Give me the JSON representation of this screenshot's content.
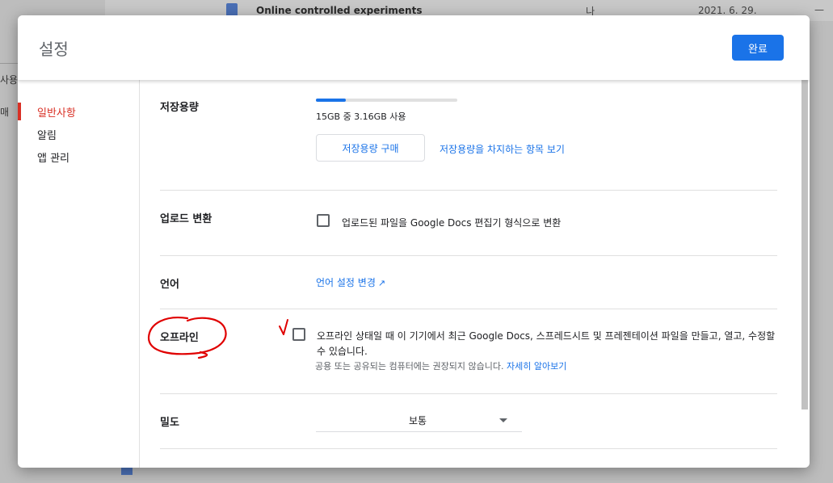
{
  "background": {
    "file_title": "Online controlled experiments",
    "owner": "나",
    "date": "2021. 6. 29.",
    "size": "—",
    "side_a": "사용",
    "side_b": "매"
  },
  "dialog": {
    "title": "설정",
    "done_label": "완료"
  },
  "sidebar": {
    "items": [
      {
        "label": "일반사항",
        "active": true
      },
      {
        "label": "알림",
        "active": false
      },
      {
        "label": "앱 관리",
        "active": false
      }
    ]
  },
  "storage": {
    "label": "저장용량",
    "usage_text": "15GB 중 3.16GB 사용",
    "used_fraction": 0.21,
    "buy_label": "저장용량 구매",
    "view_link": "저장용량을 차지하는 항목 보기"
  },
  "upload": {
    "label": "업로드 변환",
    "checkbox_text": "업로드된 파일을 Google Docs 편집기 형식으로 변환",
    "checked": false
  },
  "language": {
    "label": "언어",
    "link": "언어 설정 변경"
  },
  "offline": {
    "label": "오프라인",
    "checkbox_text": "오프라인 상태일 때 이 기기에서 최근 Google Docs, 스프레드시트 및 프레젠테이션 파일을 만들고, 열고, 수정할 수 있습니다.",
    "sub_text": "공용 또는 공유되는 컴퓨터에는 권장되지 않습니다.",
    "learn_more": "자세히 알아보기",
    "checked": false
  },
  "density": {
    "label": "밀도",
    "value": "보통"
  },
  "colors": {
    "accent": "#1a73e8",
    "active_nav": "#d93025",
    "annotation": "#e00000"
  }
}
